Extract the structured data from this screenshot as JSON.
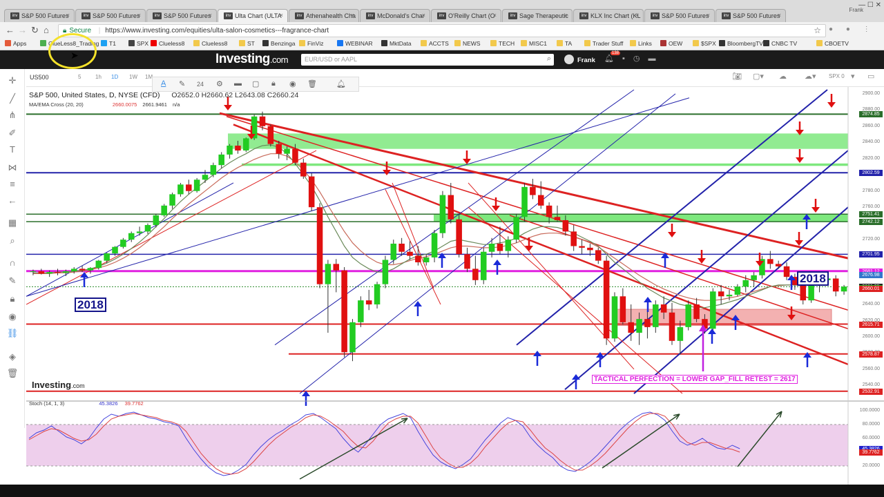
{
  "browser": {
    "tabs": [
      {
        "label": "S&P 500 Futures",
        "active": false
      },
      {
        "label": "S&P 500 Futures",
        "active": false
      },
      {
        "label": "S&P 500 Futures",
        "active": false
      },
      {
        "label": "Ulta Chart (ULTA",
        "active": true
      },
      {
        "label": "Athenahealth Cha",
        "active": false
      },
      {
        "label": "McDonald's Char",
        "active": false
      },
      {
        "label": "O'Reilly Chart (O",
        "active": false
      },
      {
        "label": "Sage Therapeutic",
        "active": false
      },
      {
        "label": "KLX Inc Chart (KL",
        "active": false
      },
      {
        "label": "S&P 500 Futures",
        "active": false
      },
      {
        "label": "S&P 500 Futures",
        "active": false
      }
    ],
    "profile": "Frank",
    "url_secure": "Secure",
    "url": "https://www.investing.com/equities/ulta-salon-cosmetics---fragrance-chart",
    "bookmarks": [
      "Apps",
      "ClueLess8_Trading",
      "T1",
      "SPX",
      "Clueless8",
      "Clueless8",
      "ST",
      "Benzinga",
      "FinViz",
      "WEBINAR",
      "MktData",
      "ACCTS",
      "NEWS",
      "TECH",
      "MISC1",
      "TA",
      "Trader Stuff",
      "Links",
      "OEW",
      "$SPX",
      "BloombergTV",
      "CNBC TV",
      "CBOETV"
    ]
  },
  "site": {
    "logo": "Investing",
    "logo_suffix": ".com",
    "search_placeholder": "EUR/USD or AAPL",
    "user": "Frank",
    "notif_count": "138"
  },
  "toolbar": {
    "symbol": "US500",
    "intervals": [
      "5",
      "1h",
      "1D",
      "1W",
      "1M"
    ],
    "font_size": "24",
    "compare": "SPX 0"
  },
  "legend": {
    "title": "S&P 500, United States, D, NYSE (CFD)",
    "ohlc": "O2652.0   H2660.62   L2643.08   C2660.24",
    "ma_label": "MA/EMA Cross (20, 20)",
    "ma_val1": "2660.0075",
    "ma_val2": "2661.9461",
    "ma_val3": "n/a"
  },
  "stoch": {
    "label": "Stoch (14, 1, 3)",
    "k": "45.3826",
    "d": "39.7762"
  },
  "watermark": "Investing",
  "watermark_suffix": ".com",
  "annotation": "TACTICAL PERFECTION = LOWER GAP_FILL RETEST = 2617",
  "year_left": "2018",
  "year_right": "2018",
  "price_axis": {
    "ticks": [
      "2900.00",
      "2880.00",
      "2860.00",
      "2840.00",
      "2820.00",
      "2800.00",
      "2780.00",
      "2760.00",
      "2740.00",
      "2720.00",
      "2700.00",
      "2680.00",
      "2660.00",
      "2640.00",
      "2620.00",
      "2600.00",
      "2580.00",
      "2560.00",
      "2540.00"
    ],
    "labels": [
      {
        "text": "2874.85",
        "color": "#2a6e2a"
      },
      {
        "text": "2802.59",
        "color": "#2222aa"
      },
      {
        "text": "2751.41",
        "color": "#2a6e2a"
      },
      {
        "text": "2742.12",
        "color": "#2a6e2a"
      },
      {
        "text": "2701.95",
        "color": "#2222aa"
      },
      {
        "text": "2681.12",
        "color": "#e020e0"
      },
      {
        "text": "2676.98",
        "color": "#3377cc"
      },
      {
        "text": "2661.95",
        "color": "#222222"
      },
      {
        "text": "2660.24",
        "color": "#22aa22"
      },
      {
        "text": "2660.01",
        "color": "#dd2222"
      },
      {
        "text": "2615.71",
        "color": "#dd2222"
      },
      {
        "text": "2578.87",
        "color": "#dd2222"
      },
      {
        "text": "2532.91",
        "color": "#dd2222"
      }
    ]
  },
  "stoch_axis": {
    "ticks": [
      "100.0000",
      "80.0000",
      "60.0000",
      "40.0000",
      "20.0000"
    ],
    "labels": [
      {
        "text": "45.3826",
        "color": "#2222cc"
      },
      {
        "text": "39.7762",
        "color": "#dd2222"
      }
    ]
  },
  "chart_data": {
    "type": "candlestick",
    "ylim": [
      2525,
      2905
    ],
    "candles": [
      [
        2680,
        2683,
        2676,
        2681
      ],
      [
        2681,
        2684,
        2677,
        2678
      ],
      [
        2678,
        2682,
        2674,
        2680
      ],
      [
        2680,
        2684,
        2676,
        2679
      ],
      [
        2679,
        2683,
        2675,
        2681
      ],
      [
        2681,
        2686,
        2678,
        2684
      ],
      [
        2684,
        2688,
        2680,
        2682
      ],
      [
        2682,
        2686,
        2678,
        2685
      ],
      [
        2685,
        2695,
        2683,
        2694
      ],
      [
        2694,
        2704,
        2691,
        2703
      ],
      [
        2703,
        2712,
        2700,
        2711
      ],
      [
        2711,
        2722,
        2709,
        2720
      ],
      [
        2720,
        2730,
        2717,
        2728
      ],
      [
        2728,
        2736,
        2725,
        2730
      ],
      [
        2730,
        2740,
        2727,
        2738
      ],
      [
        2738,
        2752,
        2735,
        2750
      ],
      [
        2750,
        2764,
        2748,
        2762
      ],
      [
        2762,
        2778,
        2758,
        2776
      ],
      [
        2776,
        2790,
        2773,
        2788
      ],
      [
        2788,
        2794,
        2776,
        2780
      ],
      [
        2780,
        2796,
        2778,
        2794
      ],
      [
        2794,
        2806,
        2790,
        2800
      ],
      [
        2800,
        2815,
        2797,
        2812
      ],
      [
        2812,
        2828,
        2808,
        2825
      ],
      [
        2825,
        2838,
        2820,
        2836
      ],
      [
        2836,
        2842,
        2826,
        2830
      ],
      [
        2830,
        2846,
        2828,
        2845
      ],
      [
        2845,
        2874,
        2843,
        2872
      ],
      [
        2872,
        2878,
        2855,
        2860
      ],
      [
        2860,
        2862,
        2835,
        2838
      ],
      [
        2838,
        2842,
        2820,
        2826
      ],
      [
        2826,
        2835,
        2818,
        2832
      ],
      [
        2832,
        2838,
        2812,
        2815
      ],
      [
        2815,
        2820,
        2795,
        2798
      ],
      [
        2798,
        2802,
        2755,
        2760
      ],
      [
        2760,
        2765,
        2660,
        2665
      ],
      [
        2665,
        2695,
        2605,
        2690
      ],
      [
        2690,
        2696,
        2655,
        2682
      ],
      [
        2682,
        2686,
        2575,
        2581
      ],
      [
        2581,
        2622,
        2570,
        2618
      ],
      [
        2618,
        2650,
        2612,
        2645
      ],
      [
        2645,
        2658,
        2633,
        2640
      ],
      [
        2640,
        2668,
        2635,
        2665
      ],
      [
        2665,
        2700,
        2660,
        2695
      ],
      [
        2695,
        2720,
        2690,
        2715
      ],
      [
        2715,
        2722,
        2700,
        2705
      ],
      [
        2705,
        2718,
        2695,
        2700
      ],
      [
        2700,
        2712,
        2688,
        2692
      ],
      [
        2692,
        2702,
        2688,
        2698
      ],
      [
        2698,
        2732,
        2692,
        2728
      ],
      [
        2728,
        2780,
        2722,
        2775
      ],
      [
        2775,
        2790,
        2740,
        2745
      ],
      [
        2745,
        2752,
        2698,
        2702
      ],
      [
        2702,
        2710,
        2680,
        2684
      ],
      [
        2684,
        2700,
        2664,
        2670
      ],
      [
        2670,
        2710,
        2665,
        2705
      ],
      [
        2705,
        2722,
        2698,
        2715
      ],
      [
        2715,
        2736,
        2702,
        2706
      ],
      [
        2706,
        2724,
        2698,
        2720
      ],
      [
        2720,
        2752,
        2716,
        2748
      ],
      [
        2748,
        2790,
        2742,
        2785
      ],
      [
        2785,
        2795,
        2770,
        2775
      ],
      [
        2775,
        2792,
        2758,
        2762
      ],
      [
        2762,
        2766,
        2740,
        2748
      ],
      [
        2748,
        2762,
        2742,
        2744
      ],
      [
        2744,
        2750,
        2725,
        2730
      ],
      [
        2730,
        2738,
        2706,
        2712
      ],
      [
        2712,
        2720,
        2702,
        2710
      ],
      [
        2710,
        2715,
        2700,
        2707
      ],
      [
        2707,
        2710,
        2690,
        2694
      ],
      [
        2694,
        2700,
        2590,
        2598
      ],
      [
        2598,
        2655,
        2594,
        2650
      ],
      [
        2650,
        2660,
        2615,
        2618
      ],
      [
        2618,
        2640,
        2595,
        2605
      ],
      [
        2605,
        2630,
        2590,
        2622
      ],
      [
        2622,
        2632,
        2598,
        2612
      ],
      [
        2612,
        2645,
        2605,
        2640
      ],
      [
        2640,
        2650,
        2622,
        2630
      ],
      [
        2630,
        2642,
        2590,
        2595
      ],
      [
        2595,
        2620,
        2578,
        2612
      ],
      [
        2612,
        2645,
        2608,
        2640
      ],
      [
        2640,
        2648,
        2618,
        2622
      ],
      [
        2622,
        2628,
        2604,
        2610
      ],
      [
        2610,
        2660,
        2606,
        2656
      ],
      [
        2656,
        2664,
        2640,
        2650
      ],
      [
        2650,
        2658,
        2645,
        2652
      ],
      [
        2652,
        2665,
        2650,
        2662
      ],
      [
        2662,
        2676,
        2655,
        2670
      ],
      [
        2670,
        2680,
        2662,
        2676
      ],
      [
        2676,
        2700,
        2672,
        2696
      ],
      [
        2696,
        2706,
        2684,
        2690
      ],
      [
        2690,
        2694,
        2684,
        2687
      ],
      [
        2687,
        2692,
        2670,
        2674
      ],
      [
        2674,
        2678,
        2658,
        2664
      ],
      [
        2664,
        2674,
        2640,
        2645
      ],
      [
        2645,
        2668,
        2642,
        2663
      ],
      [
        2663,
        2675,
        2655,
        2670
      ],
      [
        2670,
        2678,
        2664,
        2672
      ],
      [
        2672,
        2676,
        2650,
        2656
      ],
      [
        2656,
        2664,
        2652,
        2662
      ]
    ],
    "stoch_k": [
      60,
      68,
      72,
      78,
      70,
      62,
      58,
      52,
      60,
      75,
      88,
      95,
      92,
      96,
      98,
      94,
      90,
      88,
      84,
      82,
      78,
      60,
      44,
      30,
      18,
      10,
      6,
      8,
      14,
      22,
      36,
      48,
      58,
      66,
      72,
      80,
      86,
      94,
      96,
      90,
      82,
      74,
      60,
      48,
      40,
      52,
      66,
      80,
      88,
      92,
      96,
      90,
      70,
      52,
      36,
      26,
      20,
      16,
      22,
      30,
      44,
      58,
      70,
      82,
      90,
      86,
      78,
      62,
      50,
      40,
      32,
      20,
      14,
      12,
      18,
      26,
      36,
      48,
      60,
      72,
      82,
      90,
      96,
      98,
      94,
      86,
      70,
      56,
      50,
      54,
      60,
      52,
      46,
      44,
      50,
      45
    ],
    "stoch_d": [
      58,
      64,
      70,
      74,
      72,
      66,
      60,
      56,
      58,
      66,
      78,
      88,
      92,
      94,
      96,
      94,
      92,
      90,
      86,
      84,
      80,
      70,
      54,
      38,
      26,
      16,
      10,
      8,
      10,
      16,
      26,
      38,
      50,
      60,
      68,
      76,
      82,
      90,
      94,
      92,
      86,
      78,
      70,
      58,
      48,
      46,
      56,
      70,
      82,
      88,
      92,
      92,
      82,
      64,
      46,
      32,
      24,
      18,
      18,
      24,
      34,
      48,
      60,
      72,
      82,
      86,
      84,
      72,
      58,
      46,
      38,
      28,
      20,
      14,
      14,
      20,
      28,
      38,
      50,
      62,
      74,
      84,
      92,
      96,
      96,
      92,
      80,
      64,
      54,
      50,
      54,
      54,
      50,
      46,
      44,
      40
    ],
    "ma_fast": [
      2679,
      2679,
      2679,
      2680,
      2680,
      2681,
      2682,
      2684,
      2687,
      2691,
      2696,
      2702,
      2709,
      2717,
      2726,
      2736,
      2746,
      2757,
      2767,
      2776,
      2784,
      2792,
      2800,
      2808,
      2815,
      2821,
      2826,
      2832,
      2836,
      2837,
      2834,
      2826,
      2814,
      2800,
      2786,
      2768,
      2748,
      2730,
      2712,
      2698,
      2690,
      2684,
      2680,
      2680,
      2684,
      2690,
      2696,
      2700,
      2702,
      2706,
      2712,
      2718,
      2720,
      2718,
      2716,
      2714,
      2714,
      2716,
      2718,
      2722,
      2728,
      2733,
      2736,
      2736,
      2735,
      2732,
      2728,
      2723,
      2718,
      2712,
      2702,
      2692,
      2684,
      2676,
      2668,
      2660,
      2654,
      2648,
      2644,
      2640,
      2638,
      2636,
      2636,
      2638,
      2640,
      2643,
      2646,
      2650,
      2654,
      2658,
      2662,
      2664,
      2664,
      2664,
      2664,
      2664
    ],
    "ma_slow": [
      2678,
      2678,
      2678,
      2679,
      2679,
      2680,
      2681,
      2683,
      2685,
      2688,
      2692,
      2697,
      2703,
      2710,
      2718,
      2727,
      2736,
      2746,
      2755,
      2764,
      2772,
      2780,
      2788,
      2796,
      2803,
      2809,
      2814,
      2819,
      2823,
      2826,
      2826,
      2823,
      2816,
      2806,
      2794,
      2779,
      2762,
      2746,
      2730,
      2716,
      2706,
      2698,
      2692,
      2689,
      2689,
      2691,
      2694,
      2697,
      2699,
      2702,
      2706,
      2710,
      2712,
      2712,
      2711,
      2710,
      2710,
      2711,
      2713,
      2716,
      2720,
      2724,
      2727,
      2728,
      2728,
      2726,
      2724,
      2720,
      2716,
      2711,
      2704,
      2697,
      2690,
      2683,
      2676,
      2670,
      2664,
      2659,
      2655,
      2651,
      2648,
      2646,
      2645,
      2645,
      2646,
      2648,
      2650,
      2653,
      2656,
      2659,
      2662,
      2663,
      2664,
      2664,
      2664,
      2663
    ]
  }
}
